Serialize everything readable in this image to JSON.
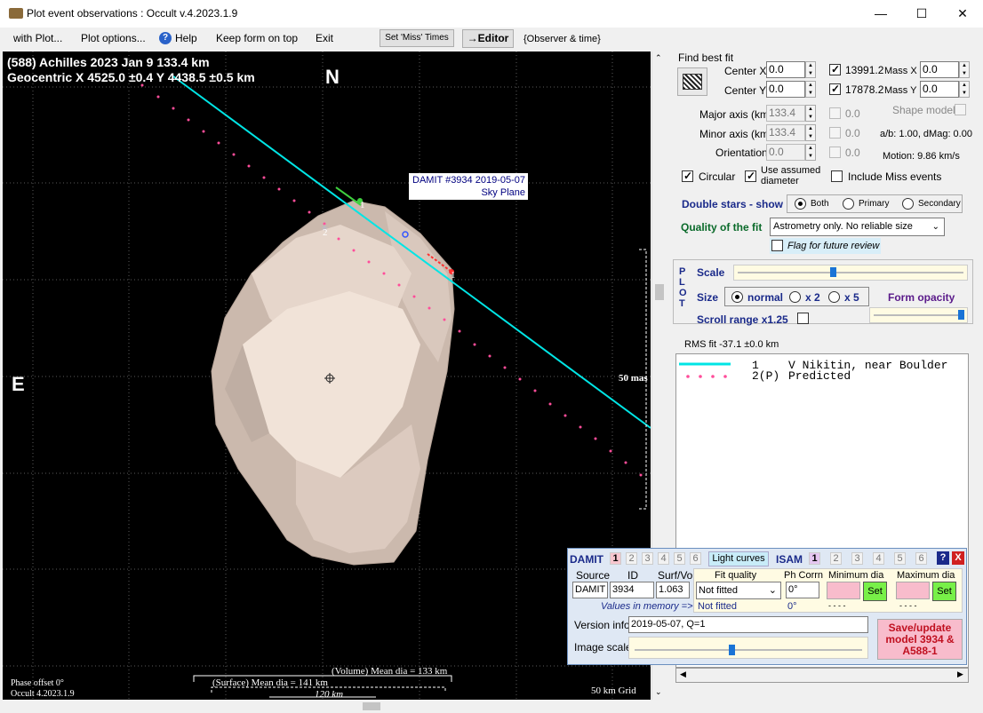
{
  "window": {
    "title": "Plot event observations : Occult v.4.2023.1.9",
    "minimize": "—",
    "maximize": "☐",
    "close": "✕"
  },
  "menu": {
    "items": [
      "with Plot...",
      "Plot options...",
      "Help",
      "Keep form on top",
      "Exit"
    ],
    "set_miss": "Set 'Miss' Times",
    "editor": "→Editor",
    "observer": "{Observer & time}"
  },
  "plot": {
    "header1": "(588) Achilles  2023 Jan 9   133.4 km",
    "header2": "Geocentric  X  4525.0 ±0.4  Y 4438.5 ±0.5 km",
    "north": "N",
    "east": "E",
    "damit_label1": "DAMIT #3934 2019-05-07",
    "damit_label2": "Sky Plane",
    "chord1": "1",
    "chord2": "2",
    "scale_label": "50 mas",
    "phase": "Phase offset 0°",
    "version": "Occult 4.2023.1.9",
    "volume": "(Volume) Mean dia = 133 km",
    "surface": "(Surface) Mean dia = 141 km",
    "km120": "120 km",
    "grid": "50 km Grid",
    "colors": {
      "chord": "#00e5e5",
      "predicted": "#ff4d9a",
      "shape": "#e8d8cc"
    }
  },
  "fit": {
    "find_best": "Find best fit",
    "center_x_label": "Center X",
    "center_x": "0.0",
    "center_y_label": "Center Y",
    "center_y": "0.0",
    "massx_val": "13991.2",
    "massx_label": "Mass X",
    "massx": "0.0",
    "massy_val": "17878.2",
    "massy_label": "Mass Y",
    "massy": "0.0",
    "major_label": "Major axis (km)",
    "major": "133.4",
    "major_fit": "0.0",
    "minor_label": "Minor axis (km)",
    "minor": "133.4",
    "minor_fit": "0.0",
    "orient_label": "Orientation",
    "orient": "0.0",
    "orient_fit": "0.0",
    "shape_model": "Shape model",
    "ab": "a/b: 1.00, dMag: 0.00",
    "motion": "Motion: 9.86 km/s",
    "circular": "Circular",
    "assumed1": "Use assumed",
    "assumed2": "diameter",
    "include_miss": "Include Miss events",
    "double_stars": "Double stars - show",
    "both": "Both",
    "primary": "Primary",
    "secondary": "Secondary",
    "quality_label": "Quality of the fit",
    "quality_value": "Astrometry only. No reliable size",
    "flag": "Flag for future review"
  },
  "plotbox": {
    "letters": [
      "P",
      "L",
      "O",
      "T"
    ],
    "scale": "Scale",
    "size": "Size",
    "normal": "normal",
    "x2": "x 2",
    "x5": "x 5",
    "form_opacity": "Form opacity",
    "scroll_range": "Scroll range x1.25"
  },
  "rms": "RMS fit -37.1 ±0.0 km",
  "legend": {
    "rows": [
      {
        "num": "1",
        "name": "V Nikitin, near Boulder"
      },
      {
        "num": "2(P)",
        "name": "Predicted"
      }
    ]
  },
  "damit": {
    "title": "DAMIT",
    "nums": [
      "1",
      "2",
      "3",
      "4",
      "5",
      "6"
    ],
    "light_curves": "Light curves",
    "isam": "ISAM",
    "isam_nums": [
      "1",
      "2",
      "3",
      "4",
      "5",
      "6"
    ],
    "help": "?",
    "close": "X",
    "source_h": "Source",
    "id_h": "ID",
    "surf_h": "Surf/Vol",
    "fitq_h": "Fit quality",
    "phcorr_h": "Ph Corrn",
    "mindia_h": "Minimum dia",
    "maxdia_h": "Maximum dia",
    "source": "DAMIT",
    "id": "3934",
    "surf": "1.063",
    "fitq": "Not fitted",
    "phcorr": "0°",
    "set": "Set",
    "mem_label": "Values in memory =>",
    "mem_fit": "Not fitted",
    "mem_ph": "0°",
    "mem_min": "- - - -",
    "mem_max": "- - - -",
    "version_label": "Version info",
    "version": "2019-05-07, Q=1",
    "image_scale": "Image scale",
    "save": "Save/update model 3934 & A588-1"
  }
}
